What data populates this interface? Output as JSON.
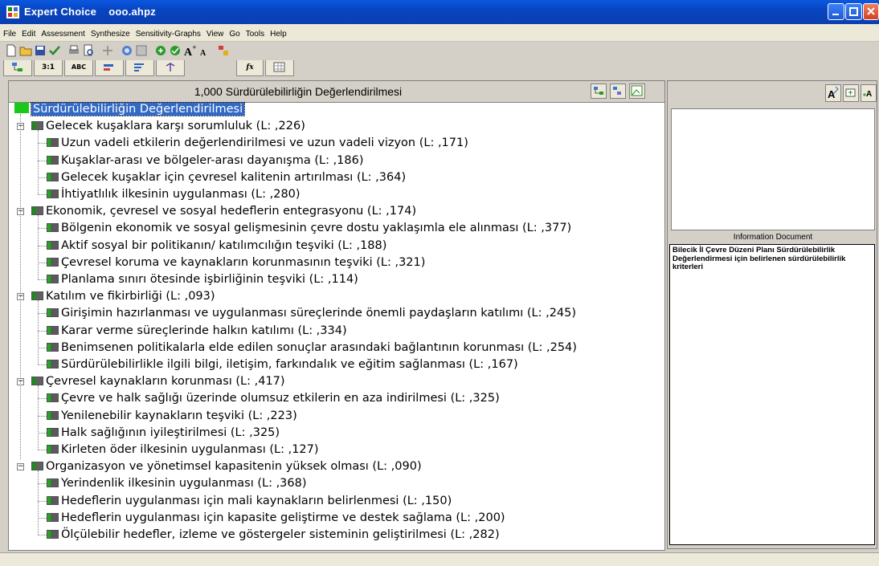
{
  "window": {
    "title": "Expert Choice    ooo.ahpz"
  },
  "menu": [
    "File",
    "Edit",
    "Assessment",
    "Synthesize",
    "Sensitivity-Graphs",
    "View",
    "Go",
    "Tools",
    "Help"
  ],
  "tabs": [
    "3:1",
    "ABC",
    "fx"
  ],
  "left_header": {
    "title": "1,000  Sürdürülebilirliğin Değerlendirilmesi"
  },
  "tree": {
    "root": "Sürdürülebilirliğin Değerlendirilmesi",
    "groups": [
      {
        "label": "Gelecek kuşaklara karşı sorumluluk (L: ,226)",
        "children": [
          "Uzun vadeli etkilerin değerlendirilmesi ve uzun vadeli vizyon (L: ,171)",
          "Kuşaklar-arası ve bölgeler-arası dayanışma (L: ,186)",
          "Gelecek kuşaklar için çevresel kalitenin artırılması (L: ,364)",
          "İhtiyatlılık ilkesinin uygulanması (L: ,280)"
        ]
      },
      {
        "label": "Ekonomik, çevresel ve sosyal hedeflerin entegrasyonu (L: ,174)",
        "children": [
          "Bölgenin ekonomik ve sosyal gelişmesinin çevre dostu yaklaşımla ele alınması (L: ,377)",
          "Aktif sosyal bir politikanın/ katılımcılığın teşviki (L: ,188)",
          "Çevresel koruma ve kaynakların korunmasının teşviki (L: ,321)",
          "Planlama sınırı ötesinde işbirliğinin teşviki (L: ,114)"
        ]
      },
      {
        "label": "Katılım ve fikirbirliği (L: ,093)",
        "children": [
          "Girişimin hazırlanması ve uygulanması süreçlerinde önemli paydaşların katılımı (L: ,245)",
          "Karar verme süreçlerinde halkın katılımı (L: ,334)",
          "Benimsenen politikalarla elde edilen sonuçlar arasındaki bağlantının korunması (L: ,254)",
          "Sürdürülebilirlikle ilgili bilgi, iletişim, farkındalık ve eğitim sağlanması (L: ,167)"
        ]
      },
      {
        "label": "Çevresel kaynakların korunması (L: ,417)",
        "children": [
          "Çevre ve halk sağlığı üzerinde olumsuz etkilerin en aza indirilmesi (L: ,325)",
          "Yenilenebilir kaynakların teşviki (L: ,223)",
          "Halk sağlığının iyileştirilmesi (L: ,325)",
          "Kirleten öder ilkesinin uygulanması (L: ,127)"
        ]
      },
      {
        "label": "Organizasyon ve yönetimsel kapasitenin yüksek olması (L: ,090)",
        "children": [
          "Yerindenlik ilkesinin uygulanması (L: ,368)",
          "Hedeflerin uygulanması için mali kaynakların belirlenmesi (L: ,150)",
          "Hedeflerin uygulanması için kapasite geliştirme ve destek sağlama (L: ,200)",
          "Ölçülebilir hedefler, izleme ve göstergeler sisteminin geliştirilmesi (L: ,282)"
        ]
      }
    ]
  },
  "info": {
    "label": "Information Document",
    "text": "Bilecik İl Çevre Düzeni Planı Sürdürülebilirlik Değerlendirmesi için belirlenen sürdürülebilirlik kriterleri"
  },
  "colors": {
    "titlebar": "#0a58e0",
    "node_green": "#1cab1c",
    "selection": "#3169c6"
  }
}
